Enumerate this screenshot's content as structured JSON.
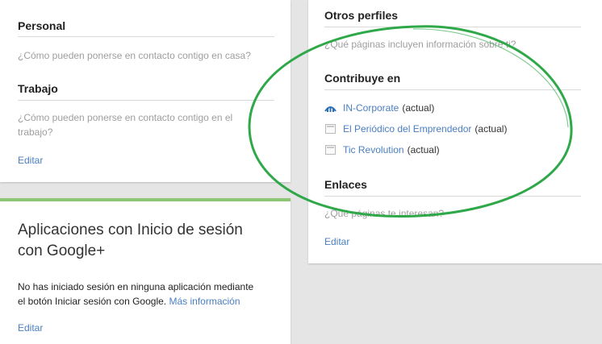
{
  "contact": {
    "personal_title": "Personal",
    "personal_hint": "¿Cómo pueden ponerse en contacto contigo en casa?",
    "work_title": "Trabajo",
    "work_hint_line1": "¿Cómo pueden ponerse en contacto contigo en el",
    "work_hint_line2": "trabajo?",
    "edit_label": "Editar"
  },
  "apps": {
    "title_line1": "Aplicaciones con Inicio de sesión",
    "title_line2": "con Google+",
    "desc_line1": "No has iniciado sesión en ninguna aplicación mediante",
    "desc_line2_prefix": "el botón Iniciar sesión con Google.",
    "more_info_link": "Más información",
    "edit_label": "Editar",
    "accent_color": "#8fc673"
  },
  "profiles": {
    "other_profiles_title": "Otros perfiles",
    "other_profiles_hint": "¿Qué páginas incluyen información sobre ti?",
    "contributes_title": "Contribuye en",
    "contributions": [
      {
        "name": "IN-Corporate",
        "status": "(actual)",
        "icon": "in-corporate-logo-icon"
      },
      {
        "name": "El Periódico del Emprendedor",
        "status": "(actual)",
        "icon": "webpage-icon"
      },
      {
        "name": "Tic Revolution",
        "status": "(actual)",
        "icon": "webpage-icon"
      }
    ],
    "links_title": "Enlaces",
    "links_hint": "¿Qué páginas te interesan?",
    "edit_label": "Editar"
  },
  "colors": {
    "background": "#e5e5e5",
    "link": "#4a7fc1",
    "annotation_circle": "#2fa84a"
  }
}
